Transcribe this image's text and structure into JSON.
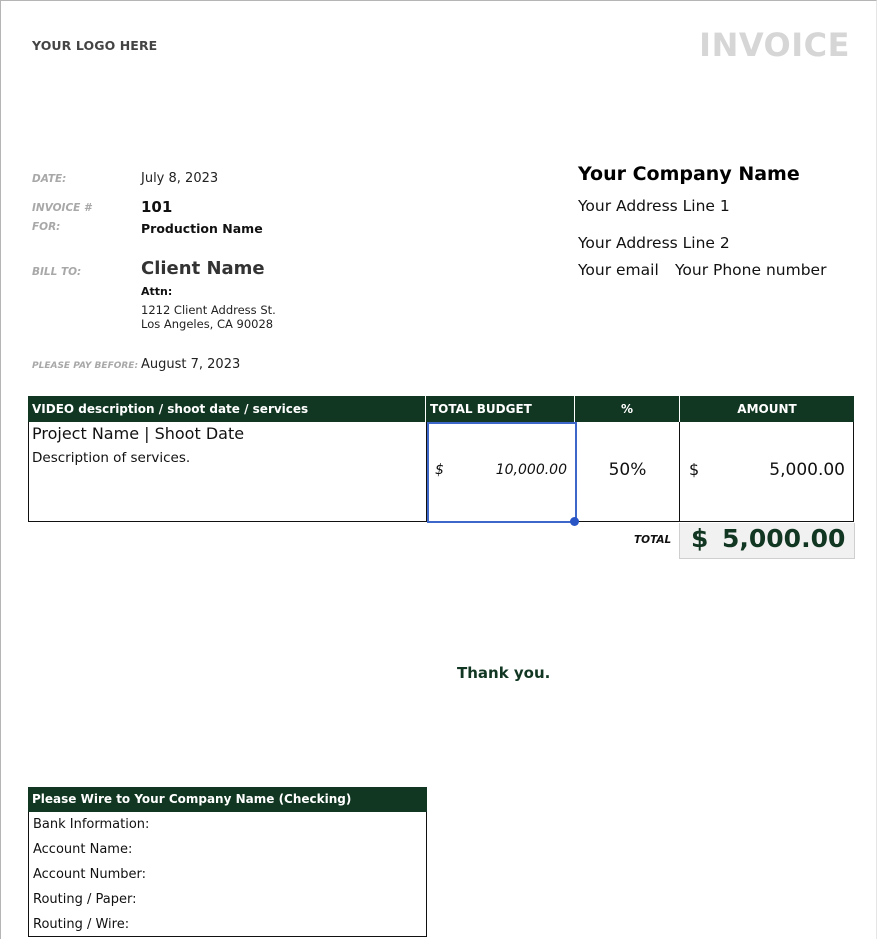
{
  "header": {
    "logo_text": "YOUR LOGO HERE",
    "title": "INVOICE"
  },
  "details": {
    "date_label": "DATE:",
    "date_value": "July 8, 2023",
    "invoice_label": "INVOICE #",
    "invoice_value": "101",
    "for_label": "FOR:",
    "for_value": "Production Name",
    "bill_to_label": "BILL TO:",
    "client_name": "Client Name",
    "attn": "Attn:",
    "address_line1": "1212 Client Address St.",
    "address_line2": "Los Angeles, CA 90028",
    "pay_before_label": "PLEASE PAY BEFORE:",
    "pay_before_value": "August 7, 2023"
  },
  "company": {
    "name": "Your Company Name",
    "address1": "Your Address Line 1",
    "address2": "Your Address Line 2",
    "email": "Your email",
    "phone": "Your Phone number"
  },
  "table": {
    "headers": [
      "VIDEO description / shoot date / services",
      "TOTAL BUDGET",
      "%",
      "AMOUNT"
    ],
    "rows": [
      {
        "title": "Project Name | Shoot Date",
        "description": "Description of services.",
        "budget_currency": "$",
        "budget": "10,000.00",
        "percent": "50%",
        "amount_currency": "$",
        "amount": "5,000.00"
      }
    ],
    "total_label": "TOTAL",
    "total_currency": "$",
    "total_value": "5,000.00"
  },
  "thank_you": "Thank you.",
  "wire": {
    "heading": "Please Wire to  Your Company Name (Checking)",
    "rows": [
      "Bank Information:",
      "Account Name:",
      "Account Number:",
      "Routing / Paper:",
      "Routing / Wire:"
    ]
  },
  "colors": {
    "brand_green": "#113622",
    "selection_blue": "#3d67c8",
    "title_gray": "#d6d6d6"
  }
}
